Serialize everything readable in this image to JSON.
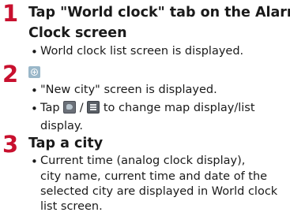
{
  "steps": [
    {
      "number": "1",
      "title_line1": "Tap \"World clock\" tab on the Alarm",
      "title_line2": "Clock screen",
      "bullets": [
        {
          "text": "World clock list screen is displayed."
        }
      ]
    },
    {
      "number": "2",
      "icon": "add-city-icon",
      "bullets": [
        {
          "text": "\"New city\" screen is displayed."
        },
        {
          "pre": "Tap",
          "icon_a": "map-display-icon",
          "sep": "/",
          "icon_b": "list-display-icon",
          "post": "to change map display/list",
          "line2": "display."
        }
      ]
    },
    {
      "number": "3",
      "title_line1": "Tap a city",
      "bullets": [
        {
          "line1": "Current time (analog clock display),",
          "line2": "city name, current time and date of the",
          "line3": "selected city are displayed in World clock",
          "line4": "list screen."
        }
      ]
    }
  ],
  "bullet_char": "•",
  "colors": {
    "step_number": "#c8102e",
    "text": "#1a1a1a"
  }
}
